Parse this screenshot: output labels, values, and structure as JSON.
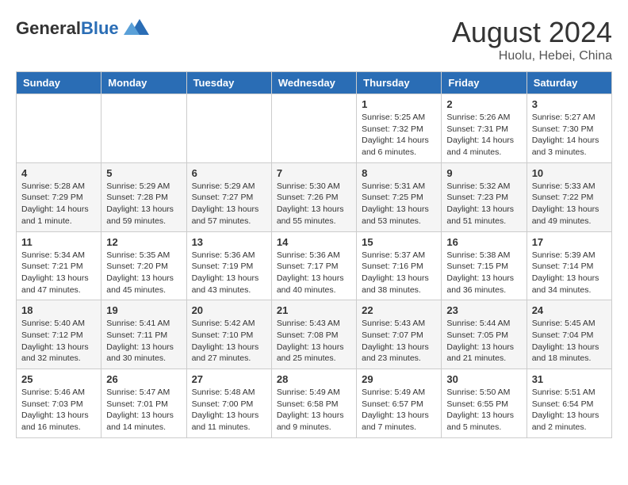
{
  "header": {
    "logo_general": "General",
    "logo_blue": "Blue",
    "month_year": "August 2024",
    "location": "Huolu, Hebei, China"
  },
  "weekdays": [
    "Sunday",
    "Monday",
    "Tuesday",
    "Wednesday",
    "Thursday",
    "Friday",
    "Saturday"
  ],
  "weeks": [
    [
      {
        "day": "",
        "info": ""
      },
      {
        "day": "",
        "info": ""
      },
      {
        "day": "",
        "info": ""
      },
      {
        "day": "",
        "info": ""
      },
      {
        "day": "1",
        "info": "Sunrise: 5:25 AM\nSunset: 7:32 PM\nDaylight: 14 hours and 6 minutes."
      },
      {
        "day": "2",
        "info": "Sunrise: 5:26 AM\nSunset: 7:31 PM\nDaylight: 14 hours and 4 minutes."
      },
      {
        "day": "3",
        "info": "Sunrise: 5:27 AM\nSunset: 7:30 PM\nDaylight: 14 hours and 3 minutes."
      }
    ],
    [
      {
        "day": "4",
        "info": "Sunrise: 5:28 AM\nSunset: 7:29 PM\nDaylight: 14 hours and 1 minute."
      },
      {
        "day": "5",
        "info": "Sunrise: 5:29 AM\nSunset: 7:28 PM\nDaylight: 13 hours and 59 minutes."
      },
      {
        "day": "6",
        "info": "Sunrise: 5:29 AM\nSunset: 7:27 PM\nDaylight: 13 hours and 57 minutes."
      },
      {
        "day": "7",
        "info": "Sunrise: 5:30 AM\nSunset: 7:26 PM\nDaylight: 13 hours and 55 minutes."
      },
      {
        "day": "8",
        "info": "Sunrise: 5:31 AM\nSunset: 7:25 PM\nDaylight: 13 hours and 53 minutes."
      },
      {
        "day": "9",
        "info": "Sunrise: 5:32 AM\nSunset: 7:23 PM\nDaylight: 13 hours and 51 minutes."
      },
      {
        "day": "10",
        "info": "Sunrise: 5:33 AM\nSunset: 7:22 PM\nDaylight: 13 hours and 49 minutes."
      }
    ],
    [
      {
        "day": "11",
        "info": "Sunrise: 5:34 AM\nSunset: 7:21 PM\nDaylight: 13 hours and 47 minutes."
      },
      {
        "day": "12",
        "info": "Sunrise: 5:35 AM\nSunset: 7:20 PM\nDaylight: 13 hours and 45 minutes."
      },
      {
        "day": "13",
        "info": "Sunrise: 5:36 AM\nSunset: 7:19 PM\nDaylight: 13 hours and 43 minutes."
      },
      {
        "day": "14",
        "info": "Sunrise: 5:36 AM\nSunset: 7:17 PM\nDaylight: 13 hours and 40 minutes."
      },
      {
        "day": "15",
        "info": "Sunrise: 5:37 AM\nSunset: 7:16 PM\nDaylight: 13 hours and 38 minutes."
      },
      {
        "day": "16",
        "info": "Sunrise: 5:38 AM\nSunset: 7:15 PM\nDaylight: 13 hours and 36 minutes."
      },
      {
        "day": "17",
        "info": "Sunrise: 5:39 AM\nSunset: 7:14 PM\nDaylight: 13 hours and 34 minutes."
      }
    ],
    [
      {
        "day": "18",
        "info": "Sunrise: 5:40 AM\nSunset: 7:12 PM\nDaylight: 13 hours and 32 minutes."
      },
      {
        "day": "19",
        "info": "Sunrise: 5:41 AM\nSunset: 7:11 PM\nDaylight: 13 hours and 30 minutes."
      },
      {
        "day": "20",
        "info": "Sunrise: 5:42 AM\nSunset: 7:10 PM\nDaylight: 13 hours and 27 minutes."
      },
      {
        "day": "21",
        "info": "Sunrise: 5:43 AM\nSunset: 7:08 PM\nDaylight: 13 hours and 25 minutes."
      },
      {
        "day": "22",
        "info": "Sunrise: 5:43 AM\nSunset: 7:07 PM\nDaylight: 13 hours and 23 minutes."
      },
      {
        "day": "23",
        "info": "Sunrise: 5:44 AM\nSunset: 7:05 PM\nDaylight: 13 hours and 21 minutes."
      },
      {
        "day": "24",
        "info": "Sunrise: 5:45 AM\nSunset: 7:04 PM\nDaylight: 13 hours and 18 minutes."
      }
    ],
    [
      {
        "day": "25",
        "info": "Sunrise: 5:46 AM\nSunset: 7:03 PM\nDaylight: 13 hours and 16 minutes."
      },
      {
        "day": "26",
        "info": "Sunrise: 5:47 AM\nSunset: 7:01 PM\nDaylight: 13 hours and 14 minutes."
      },
      {
        "day": "27",
        "info": "Sunrise: 5:48 AM\nSunset: 7:00 PM\nDaylight: 13 hours and 11 minutes."
      },
      {
        "day": "28",
        "info": "Sunrise: 5:49 AM\nSunset: 6:58 PM\nDaylight: 13 hours and 9 minutes."
      },
      {
        "day": "29",
        "info": "Sunrise: 5:49 AM\nSunset: 6:57 PM\nDaylight: 13 hours and 7 minutes."
      },
      {
        "day": "30",
        "info": "Sunrise: 5:50 AM\nSunset: 6:55 PM\nDaylight: 13 hours and 5 minutes."
      },
      {
        "day": "31",
        "info": "Sunrise: 5:51 AM\nSunset: 6:54 PM\nDaylight: 13 hours and 2 minutes."
      }
    ]
  ]
}
